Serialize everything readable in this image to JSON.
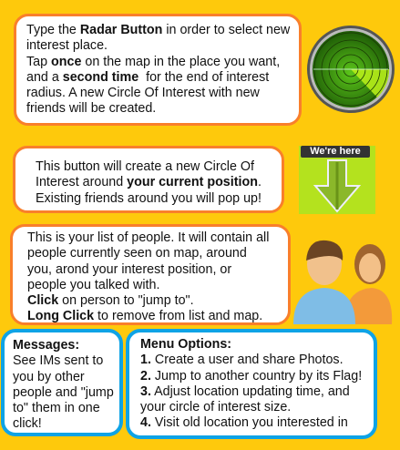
{
  "radar_box": {
    "l1a": "Type the ",
    "l1b": "Radar Button",
    "l1c": " in order to select new",
    "l2": "interest place.",
    "l3a": "Tap ",
    "l3b": "once",
    "l3c": " on the map in the place you want,",
    "l4a": "and a ",
    "l4b": "second time",
    "l4c": "  for the end of interest",
    "l5": "radius. A new Circle Of Interest with new",
    "l6": "friends will be created."
  },
  "here_box": {
    "l1": "This button will create a new Circle Of",
    "l2a": "Interest around ",
    "l2b": "your current position",
    "l2c": ".",
    "l3": "Existing friends around you will pop up!",
    "image_label": "We're here"
  },
  "people_box": {
    "l1": "This is your list of people. It will contain all",
    "l2": "people currently seen on map, around",
    "l3": "you, arond your interest position, or",
    "l4": "people you talked with.",
    "l5a": "Click",
    "l5b": " on person to \"jump to\".",
    "l6a": "Long Click",
    "l6b": " to remove from list and map."
  },
  "messages_box": {
    "title": "Messages:",
    "lines": [
      "See IMs sent to",
      "you by other",
      "people and \"jump",
      "to\" them in one",
      "click!"
    ]
  },
  "menu_box": {
    "title": "Menu Options:",
    "items": [
      {
        "num": "1.",
        "text": " Create a user and share Photos."
      },
      {
        "num": "2.",
        "text": " Jump to another country by its Flag!"
      },
      {
        "num": "3.",
        "text": " Adjust location updating time, and"
      },
      {
        "num": "",
        "text": "your circle of interest size."
      },
      {
        "num": "4.",
        "text": " Visit old location you interested in"
      }
    ]
  },
  "icons": [
    "radar-icon",
    "we-are-here-arrow-icon",
    "people-icon"
  ],
  "colors": {
    "background": "#fec90c",
    "orange_border": "#f97f2b",
    "blue_border": "#0ea3e6"
  }
}
